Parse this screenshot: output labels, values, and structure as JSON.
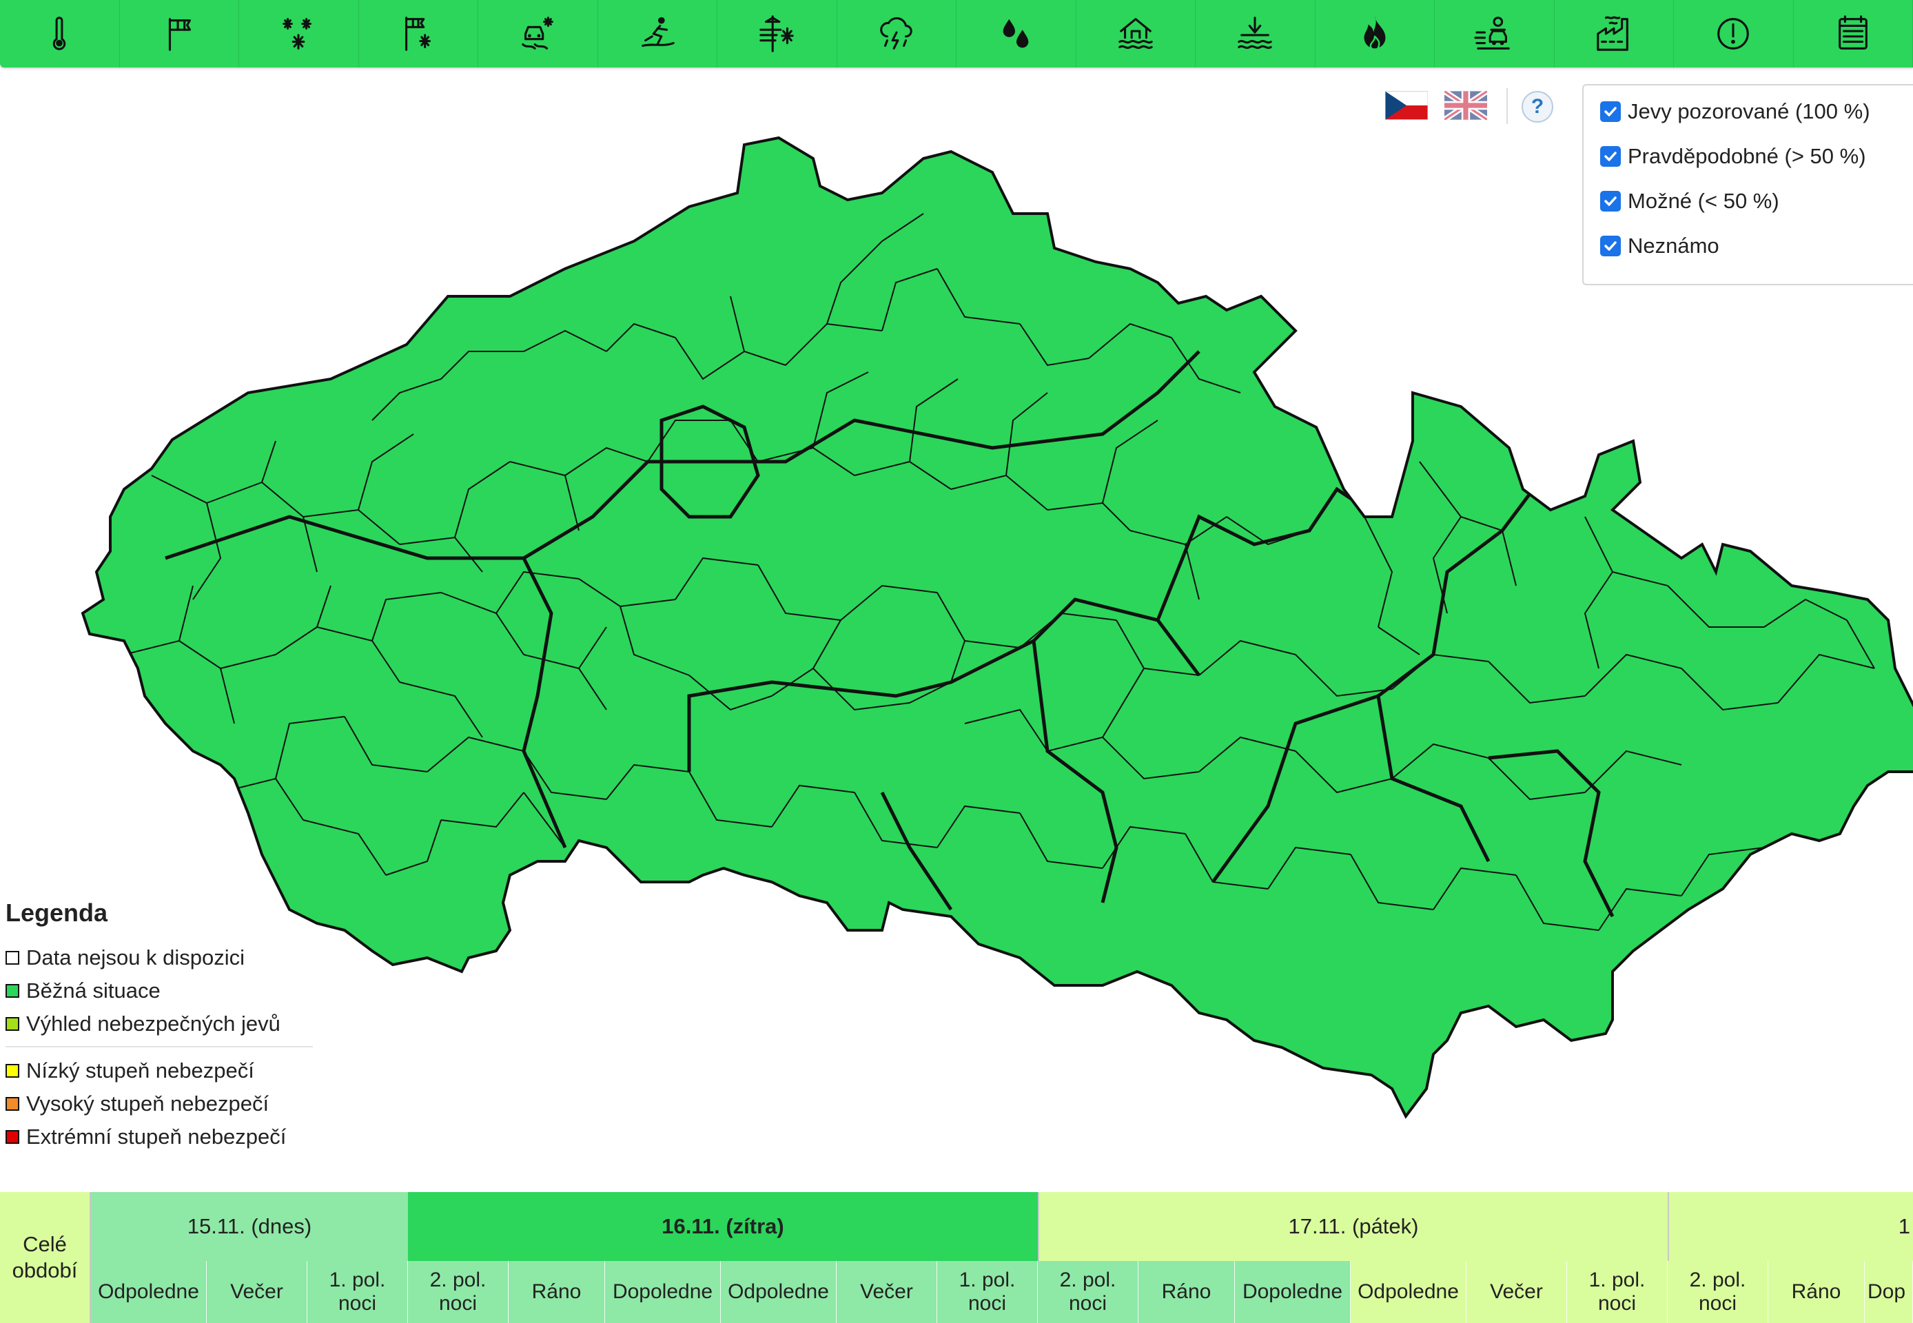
{
  "toolbar": {
    "items": [
      {
        "icon": "thermometer-icon"
      },
      {
        "icon": "wind-flag-icon"
      },
      {
        "icon": "snow-icon"
      },
      {
        "icon": "snow-wind-flag-icon"
      },
      {
        "icon": "slippery-road-icon"
      },
      {
        "icon": "ice-skater-icon"
      },
      {
        "icon": "icing-power-line-icon"
      },
      {
        "icon": "thunderstorm-icon"
      },
      {
        "icon": "rain-drops-icon"
      },
      {
        "icon": "flood-house-icon"
      },
      {
        "icon": "water-level-icon"
      },
      {
        "icon": "fire-icon"
      },
      {
        "icon": "fog-car-icon"
      },
      {
        "icon": "smog-factory-icon"
      },
      {
        "icon": "warning-icon"
      },
      {
        "icon": "calendar-icon"
      }
    ]
  },
  "header": {
    "language_cz_icon": "czech-flag-icon",
    "language_en_icon": "uk-flag-icon",
    "help_label": "?"
  },
  "filters": [
    {
      "label": "Jevy pozorované (100 %)",
      "checked": true
    },
    {
      "label": "Pravděpodobné (> 50 %)",
      "checked": true
    },
    {
      "label": "Možné (< 50 %)",
      "checked": true
    },
    {
      "label": "Neznámo",
      "checked": true
    }
  ],
  "map": {
    "fill_color": "#2bd65b",
    "border_color": "#111111"
  },
  "legend": {
    "title": "Legenda",
    "items": [
      {
        "label": "Data nejsou k dispozici",
        "color": "#ffffff"
      },
      {
        "label": "Běžná situace",
        "color": "#2bd65b"
      },
      {
        "label": "Výhled nebezpečných jevů",
        "color": "#a4e019"
      },
      {
        "label": "Nízký stupeň nebezpečí",
        "color": "#ffff00"
      },
      {
        "label": "Vysoký stupeň nebezpečí",
        "color": "#f28c28"
      },
      {
        "label": "Extrémní stupeň nebezpečí",
        "color": "#e00000"
      }
    ]
  },
  "timeline": {
    "whole_period": "Celé\nobdobí",
    "days": [
      {
        "label": "15.11. (dnes)",
        "bg": "#8ee8a6",
        "bold": false
      },
      {
        "label": "16.11. (zítra)",
        "bg": "#2bd65b",
        "bold": true
      },
      {
        "label": "17.11. (pátek)",
        "bg": "#d9fd9c",
        "bold": false
      },
      {
        "label": "1",
        "bg": "#d9fd9c",
        "bold": false
      }
    ],
    "slots": [
      {
        "label": "Odpoledne",
        "bg": "#8ee8a6"
      },
      {
        "label": "Večer",
        "bg": "#8ee8a6"
      },
      {
        "label": "1. pol.\nnoci",
        "bg": "#8ee8a6"
      },
      {
        "label": "2. pol.\nnoci",
        "bg": "#8ee8a6"
      },
      {
        "label": "Ráno",
        "bg": "#8ee8a6"
      },
      {
        "label": "Dopoledne",
        "bg": "#8ee8a6"
      },
      {
        "label": "Odpoledne",
        "bg": "#8ee8a6"
      },
      {
        "label": "Večer",
        "bg": "#8ee8a6"
      },
      {
        "label": "1. pol.\nnoci",
        "bg": "#8ee8a6"
      },
      {
        "label": "2. pol.\nnoci",
        "bg": "#8ee8a6"
      },
      {
        "label": "Ráno",
        "bg": "#8ee8a6"
      },
      {
        "label": "Dopoledne",
        "bg": "#8ee8a6"
      },
      {
        "label": "Odpoledne",
        "bg": "#d9fd9c"
      },
      {
        "label": "Večer",
        "bg": "#d9fd9c"
      },
      {
        "label": "1. pol.\nnoci",
        "bg": "#d9fd9c"
      },
      {
        "label": "2. pol.\nnoci",
        "bg": "#d9fd9c"
      },
      {
        "label": "Ráno",
        "bg": "#d9fd9c"
      },
      {
        "label": "Dop",
        "bg": "#d9fd9c"
      }
    ]
  }
}
